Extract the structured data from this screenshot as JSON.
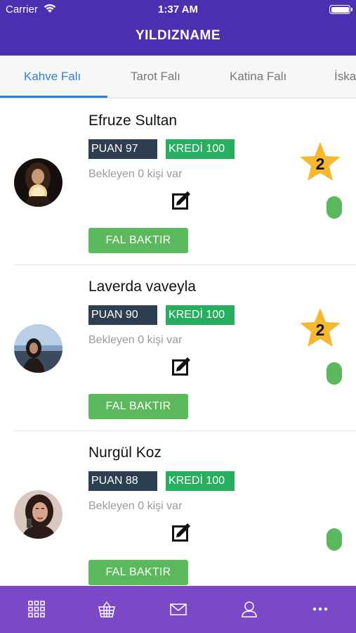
{
  "status_bar": {
    "carrier": "Carrier",
    "time": "1:37 AM"
  },
  "header": {
    "title": "YILDIZNAME"
  },
  "tabs": [
    {
      "label": "Kahve Falı",
      "active": true
    },
    {
      "label": "Tarot Falı",
      "active": false
    },
    {
      "label": "Katina Falı",
      "active": false
    },
    {
      "label": "İska",
      "active": false
    }
  ],
  "fortune_tellers": [
    {
      "name": "Efruze Sultan",
      "puan": "PUAN 97",
      "kredi": "KREDİ 100",
      "waiting": "Bekleyen 0 kişi var",
      "star_level": "2",
      "button": "FAL BAKTIR",
      "online_color": "#5cb85c"
    },
    {
      "name": "Laverda vaveyla",
      "puan": "PUAN 90",
      "kredi": "KREDİ 100",
      "waiting": "Bekleyen 0 kişi var",
      "star_level": "2",
      "button": "FAL BAKTIR",
      "online_color": "#5cb85c"
    },
    {
      "name": "Nurgül Koz",
      "puan": "PUAN 88",
      "kredi": "KREDİ 100",
      "waiting": "Bekleyen 0 kişi var",
      "star_level": null,
      "button": "FAL BAKTIR",
      "online_color": "#5cb85c"
    }
  ],
  "bottom_nav": [
    {
      "icon": "grid-icon"
    },
    {
      "icon": "basket-icon"
    },
    {
      "icon": "envelope-icon"
    },
    {
      "icon": "user-icon"
    },
    {
      "icon": "more-icon"
    }
  ],
  "colors": {
    "header": "#4a30b0",
    "bottom_nav": "#7b48c8",
    "tab_active": "#2f7fd8",
    "puan_badge": "#2c3e50",
    "kredi_badge": "#27ae60",
    "button": "#5cb85c",
    "star": "#f5b82e"
  }
}
